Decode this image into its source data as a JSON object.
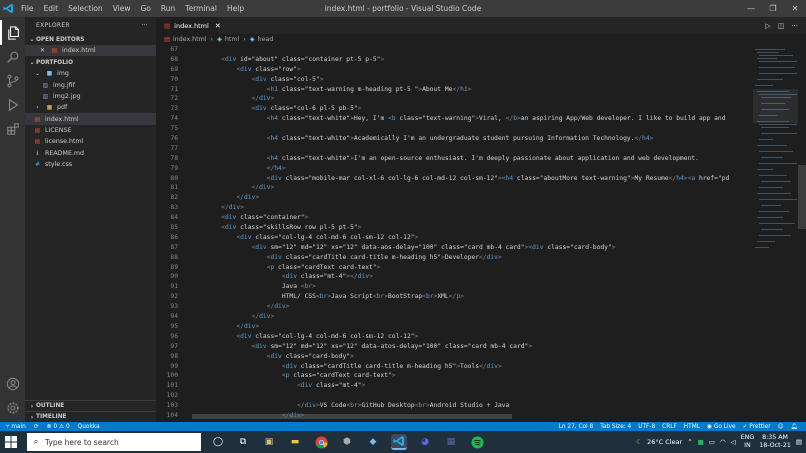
{
  "window": {
    "title": "index.html - portfolio - Visual Studio Code",
    "menu": [
      "File",
      "Edit",
      "Selection",
      "View",
      "Go",
      "Run",
      "Terminal",
      "Help"
    ]
  },
  "sidebar": {
    "header": "EXPLORER",
    "more": "···",
    "open_editors_label": "OPEN EDITORS",
    "open_editor_file": "index.html",
    "project_label": "PORTFOLIO",
    "tree": [
      {
        "label": "img",
        "type": "folder-open",
        "depth": 1
      },
      {
        "label": "img.jfif",
        "type": "image",
        "depth": 2
      },
      {
        "label": "img2.jpg",
        "type": "image",
        "depth": 2
      },
      {
        "label": "pdf",
        "type": "folder",
        "depth": 1
      },
      {
        "label": "index.html",
        "type": "html",
        "depth": 1,
        "selected": true
      },
      {
        "label": "LICENSE",
        "type": "license",
        "depth": 1
      },
      {
        "label": "license.html",
        "type": "html",
        "depth": 1
      },
      {
        "label": "README.md",
        "type": "info",
        "depth": 1
      },
      {
        "label": "style.css",
        "type": "css",
        "depth": 1
      }
    ],
    "outline_label": "OUTLINE",
    "timeline_label": "TIMELINE"
  },
  "editor": {
    "tab_label": "index.html",
    "breadcrumb": [
      "index.html",
      "html",
      "head"
    ],
    "lines": [
      {
        "n": "67",
        "c": ""
      },
      {
        "n": "68",
        "c": "    <div id=\"about\" class=\"container pt-5 p-5\">"
      },
      {
        "n": "69",
        "c": "        <div class=\"row\">"
      },
      {
        "n": "70",
        "c": "            <div class=\"col-5\">"
      },
      {
        "n": "71",
        "c": "                <h1 class=\"text-warning m-heading pt-5 \">About Me</h1>"
      },
      {
        "n": "72",
        "c": "            </div>"
      },
      {
        "n": "73",
        "c": "            <div class=\"col-6 pl-5 pb-5\">"
      },
      {
        "n": "74",
        "c": "                <h4 class=\"text-white\">Hey, I'm <b class=\"text-warning\">Viral, </b>an aspiring App/Web developer. I like to build app and"
      },
      {
        "n": "75",
        "c": ""
      },
      {
        "n": "76",
        "c": "                <h4 class=\"text-white\">Academically I'm an undergraduate student pursuing Information Technology.</h4>"
      },
      {
        "n": "77",
        "c": ""
      },
      {
        "n": "78",
        "c": "                <h4 class=\"text-white\">I'm an open-source enthusiast. I'm deeply passionate about application and web development."
      },
      {
        "n": "79",
        "c": "                </h4>"
      },
      {
        "n": "80",
        "c": "                <div class=\"mobile-mar col-xl-6 col-lg-6 col-md-12 col-sm-12\"><h4 class=\"aboutMore text-warning\">My Resume</h4><a href=\"pd"
      },
      {
        "n": "81",
        "c": "            </div>"
      },
      {
        "n": "82",
        "c": "        </div>"
      },
      {
        "n": "83",
        "c": "    </div>"
      },
      {
        "n": "84",
        "c": "    <div class=\"container\">"
      },
      {
        "n": "85",
        "c": "    <div class=\"skillsRow row pl-5 pt-5\">"
      },
      {
        "n": "86",
        "c": "        <div class=\"col-lg-4 col-md-6 col-sm-12 col-12\">"
      },
      {
        "n": "87",
        "c": "            <div sm=\"12\" md=\"12\" xs=\"12\" data-aos-delay=\"100\" class=\"card mb-4 card\"><div class=\"card-body\">"
      },
      {
        "n": "88",
        "c": "                <div class=\"cardTitle card-title m-heading h5\">Developer</div>"
      },
      {
        "n": "89",
        "c": "                <p class=\"cardText card-text\">"
      },
      {
        "n": "90",
        "c": "                    <div class=\"mt-4\"></div>"
      },
      {
        "n": "91",
        "c": "                    Java <br>"
      },
      {
        "n": "92",
        "c": "                    HTML/ CSS<br>Java Script<br>BootStrap<br>XML</p>"
      },
      {
        "n": "93",
        "c": "                </div>"
      },
      {
        "n": "94",
        "c": "            </div>"
      },
      {
        "n": "95",
        "c": "        </div>"
      },
      {
        "n": "96",
        "c": "        <div class=\"col-lg-4 col-md-6 col-sm-12 col-12\">"
      },
      {
        "n": "97",
        "c": "            <div sm=\"12\" md=\"12\" xs=\"12\" data-atos-delay=\"100\" class=\"card mb-4 card\">"
      },
      {
        "n": "98",
        "c": "                <div class=\"card-body\">"
      },
      {
        "n": "99",
        "c": "                    <div class=\"cardTitle card-title m-heading h5\">Tools</div>"
      },
      {
        "n": "100",
        "c": "                    <p class=\"cardText card-text\">"
      },
      {
        "n": "101",
        "c": "                        <div class=\"mt-4\">"
      },
      {
        "n": "102",
        "c": ""
      },
      {
        "n": "103",
        "c": "                        </div>VS Code<br>GitHub Desktop<br>Android Studio + Java"
      },
      {
        "n": "104",
        "c": "                    </div>"
      }
    ]
  },
  "status_bar": {
    "branch": "main",
    "errors": "0",
    "warnings": "0",
    "extension": "Quokka",
    "position": "Ln 27, Col 8",
    "tab_size": "Tab Size: 4",
    "encoding": "UTF-8",
    "eol": "CRLF",
    "language": "HTML",
    "go_live": "Go Live",
    "prettier": "Prettier"
  },
  "taskbar": {
    "search_placeholder": "Type here to search",
    "weather": "26°C  Clear",
    "lang_line1": "ENG",
    "lang_line2": "IN",
    "time": "8:35 AM",
    "date": "18-Oct-21"
  },
  "colors": {
    "accent": "#007acc",
    "tag": "#569cd6",
    "attribute": "#9cdcfe",
    "string": "#ce9178"
  }
}
